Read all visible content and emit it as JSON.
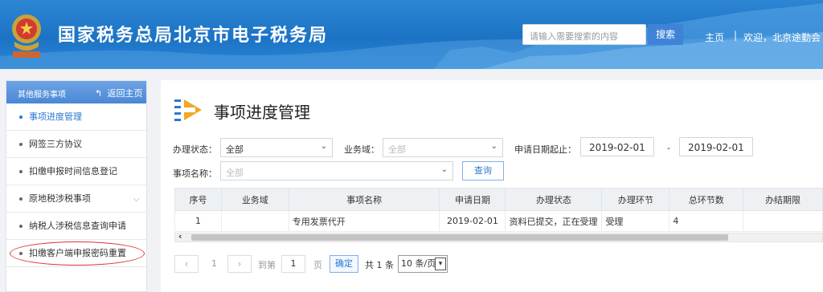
{
  "header": {
    "site_title": "国家税务总局北京市电子税务局",
    "search_placeholder": "请输入需要搜索的内容",
    "search_button": "搜索",
    "home_link": "主页",
    "separator": "|",
    "welcome": "欢迎，北京途勤会"
  },
  "sidebar": {
    "top_label": "其他服务事项",
    "back_label": "返回主页",
    "items": [
      {
        "label": "事项进度管理"
      },
      {
        "label": "网签三方协议"
      },
      {
        "label": "扣缴申报时间信息登记"
      },
      {
        "label": "原地税涉税事项"
      },
      {
        "label": "纳税人涉税信息查询申请"
      },
      {
        "label": "扣缴客户端申报密码重置"
      }
    ]
  },
  "main": {
    "title": "事项进度管理",
    "filters": {
      "status_label": "办理状态：",
      "status_value": "全部",
      "domain_label": "业务域：",
      "domain_value": "全部",
      "date_label": "申请日期起止：",
      "date_start": "2019-02-01",
      "date_dash": "-",
      "date_end": "2019-02-01",
      "name_label": "事项名称：",
      "name_value": "全部",
      "query_button": "查询"
    },
    "table": {
      "headers": [
        "序号",
        "业务域",
        "事项名称",
        "申请日期",
        "办理状态",
        "办理环节",
        "总环节数",
        "办结期限"
      ],
      "rows": [
        [
          "1",
          "",
          "专用发票代开",
          "2019-02-01",
          "资料已提交，正在受理",
          "受理",
          "4",
          ""
        ]
      ]
    },
    "pagination": {
      "prev": "‹",
      "current": "1",
      "next": "›",
      "goto_label": "到第",
      "goto_value": "1",
      "page_label": "页",
      "ok_button": "确定",
      "total": "共 1 条",
      "page_size": "10 条/页"
    }
  }
}
